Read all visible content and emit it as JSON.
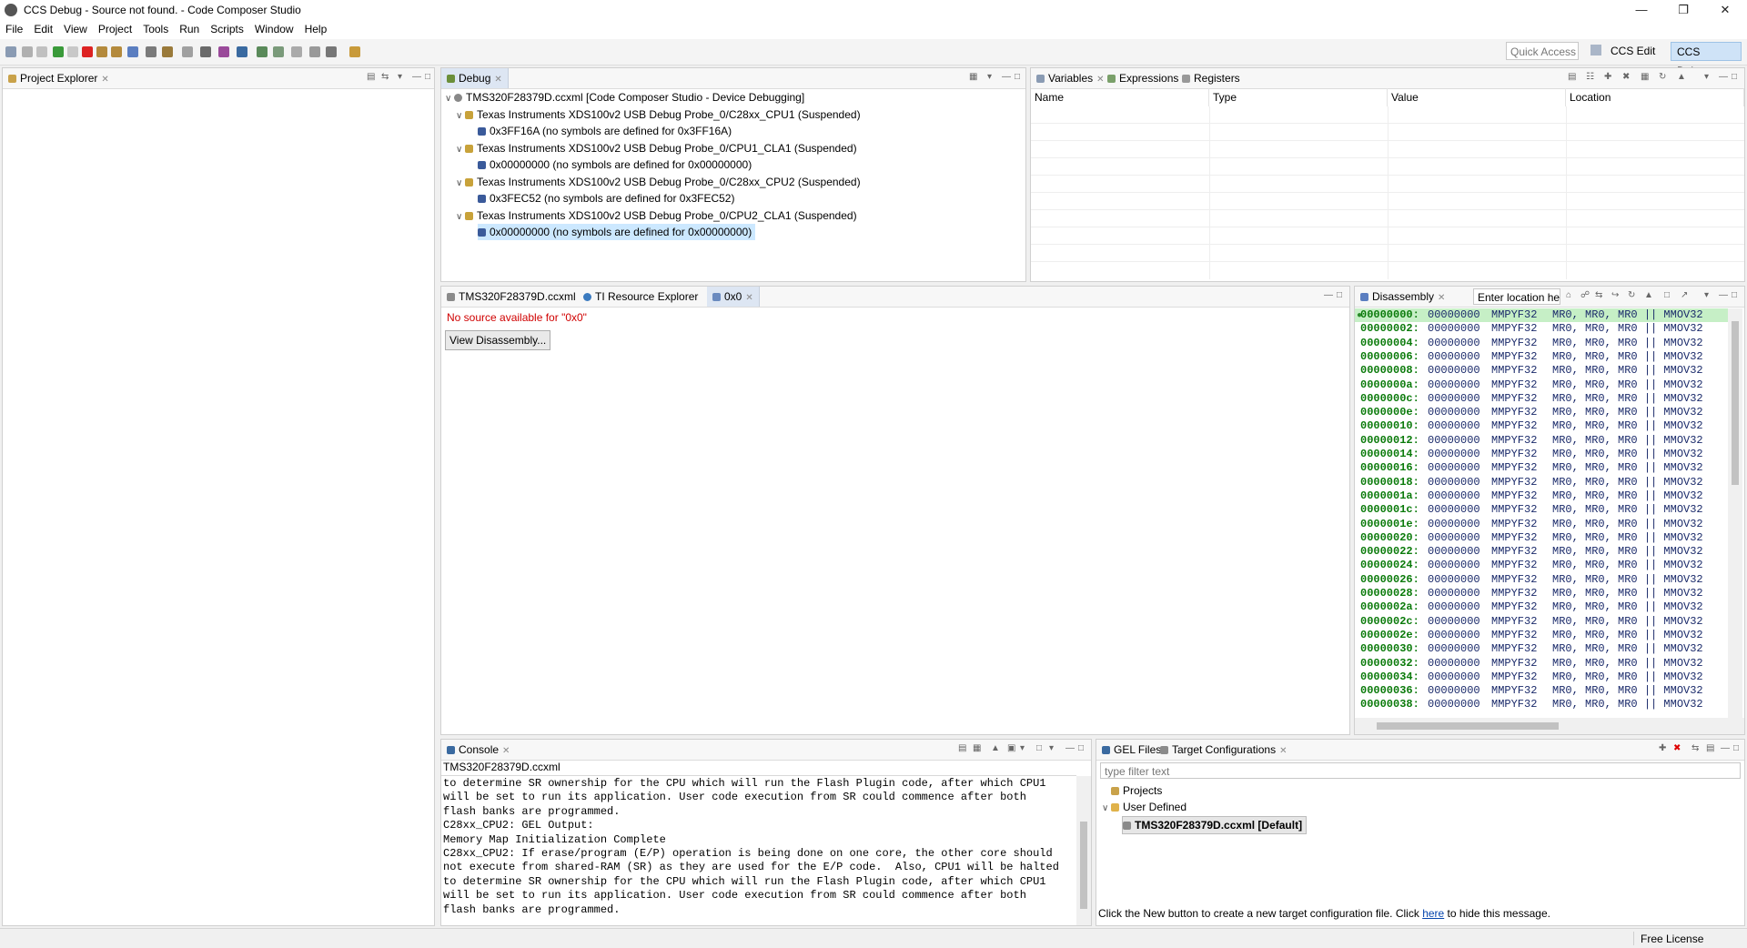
{
  "window": {
    "title": "CCS Debug - Source not found. - Code Composer Studio"
  },
  "menu": [
    "File",
    "Edit",
    "View",
    "Project",
    "Tools",
    "Run",
    "Scripts",
    "Window",
    "Help"
  ],
  "toolbar": {
    "quick_access": "Quick Access",
    "perspectives": [
      "CCS Edit",
      "CCS Debug"
    ]
  },
  "project_explorer": {
    "tab": "Project Explorer"
  },
  "debug": {
    "tab": "Debug",
    "root": "TMS320F28379D.ccxml [Code Composer Studio - Device Debugging]",
    "items": [
      {
        "label": "Texas Instruments XDS100v2 USB Debug Probe_0/C28xx_CPU1 (Suspended)",
        "frame": "0x3FF16A  (no symbols are defined for 0x3FF16A)"
      },
      {
        "label": "Texas Instruments XDS100v2 USB Debug Probe_0/CPU1_CLA1 (Suspended)",
        "frame": "0x00000000  (no symbols are defined for 0x00000000)"
      },
      {
        "label": "Texas Instruments XDS100v2 USB Debug Probe_0/C28xx_CPU2 (Suspended)",
        "frame": "0x3FEC52  (no symbols are defined for 0x3FEC52)"
      },
      {
        "label": "Texas Instruments XDS100v2 USB Debug Probe_0/CPU2_CLA1 (Suspended)",
        "frame": "0x00000000  (no symbols are defined for 0x00000000)"
      }
    ]
  },
  "variables": {
    "tabs": [
      "Variables",
      "Expressions",
      "Registers"
    ],
    "columns": [
      "Name",
      "Type",
      "Value",
      "Location"
    ]
  },
  "editor": {
    "tabs": [
      "TMS320F28379D.ccxml",
      "TI Resource Explorer",
      "0x0"
    ],
    "message": "No source available for \"0x0\"",
    "button": "View Disassembly..."
  },
  "disassembly": {
    "tab": "Disassembly",
    "location_placeholder": "Enter location here",
    "opcode": "00000000",
    "mnemonic": "MMPYF32",
    "args": "MR0, MR0, MR0 || MMOV32",
    "addresses": [
      "00000000:",
      "00000002:",
      "00000004:",
      "00000006:",
      "00000008:",
      "0000000a:",
      "0000000c:",
      "0000000e:",
      "00000010:",
      "00000012:",
      "00000014:",
      "00000016:",
      "00000018:",
      "0000001a:",
      "0000001c:",
      "0000001e:",
      "00000020:",
      "00000022:",
      "00000024:",
      "00000026:",
      "00000028:",
      "0000002a:",
      "0000002c:",
      "0000002e:",
      "00000030:",
      "00000032:",
      "00000034:",
      "00000036:",
      "00000038:"
    ]
  },
  "console": {
    "tab": "Console",
    "header": "TMS320F28379D.ccxml",
    "lines": [
      "to determine SR ownership for the CPU which will run the Flash Plugin code, after which CPU1",
      "will be set to run its application. User code execution from SR could commence after both",
      "flash banks are programmed.",
      "C28xx_CPU2: GEL Output:",
      "Memory Map Initialization Complete",
      "C28xx_CPU2: If erase/program (E/P) operation is being done on one core, the other core should",
      "not execute from shared-RAM (SR) as they are used for the E/P code.  Also, CPU1 will be halted",
      "to determine SR ownership for the CPU which will run the Flash Plugin code, after which CPU1",
      "will be set to run its application. User code execution from SR could commence after both",
      "flash banks are programmed."
    ]
  },
  "target_config": {
    "tabs": [
      "GEL Files",
      "Target Configurations"
    ],
    "filter_placeholder": "type filter text",
    "tree": {
      "projects": "Projects",
      "user_defined": "User Defined",
      "item": "TMS320F28379D.ccxml [Default]"
    },
    "hint_before": "Click the New button to create a new target configuration file. Click ",
    "hint_link": "here",
    "hint_after": " to hide this message."
  },
  "status": {
    "license": "Free License"
  }
}
